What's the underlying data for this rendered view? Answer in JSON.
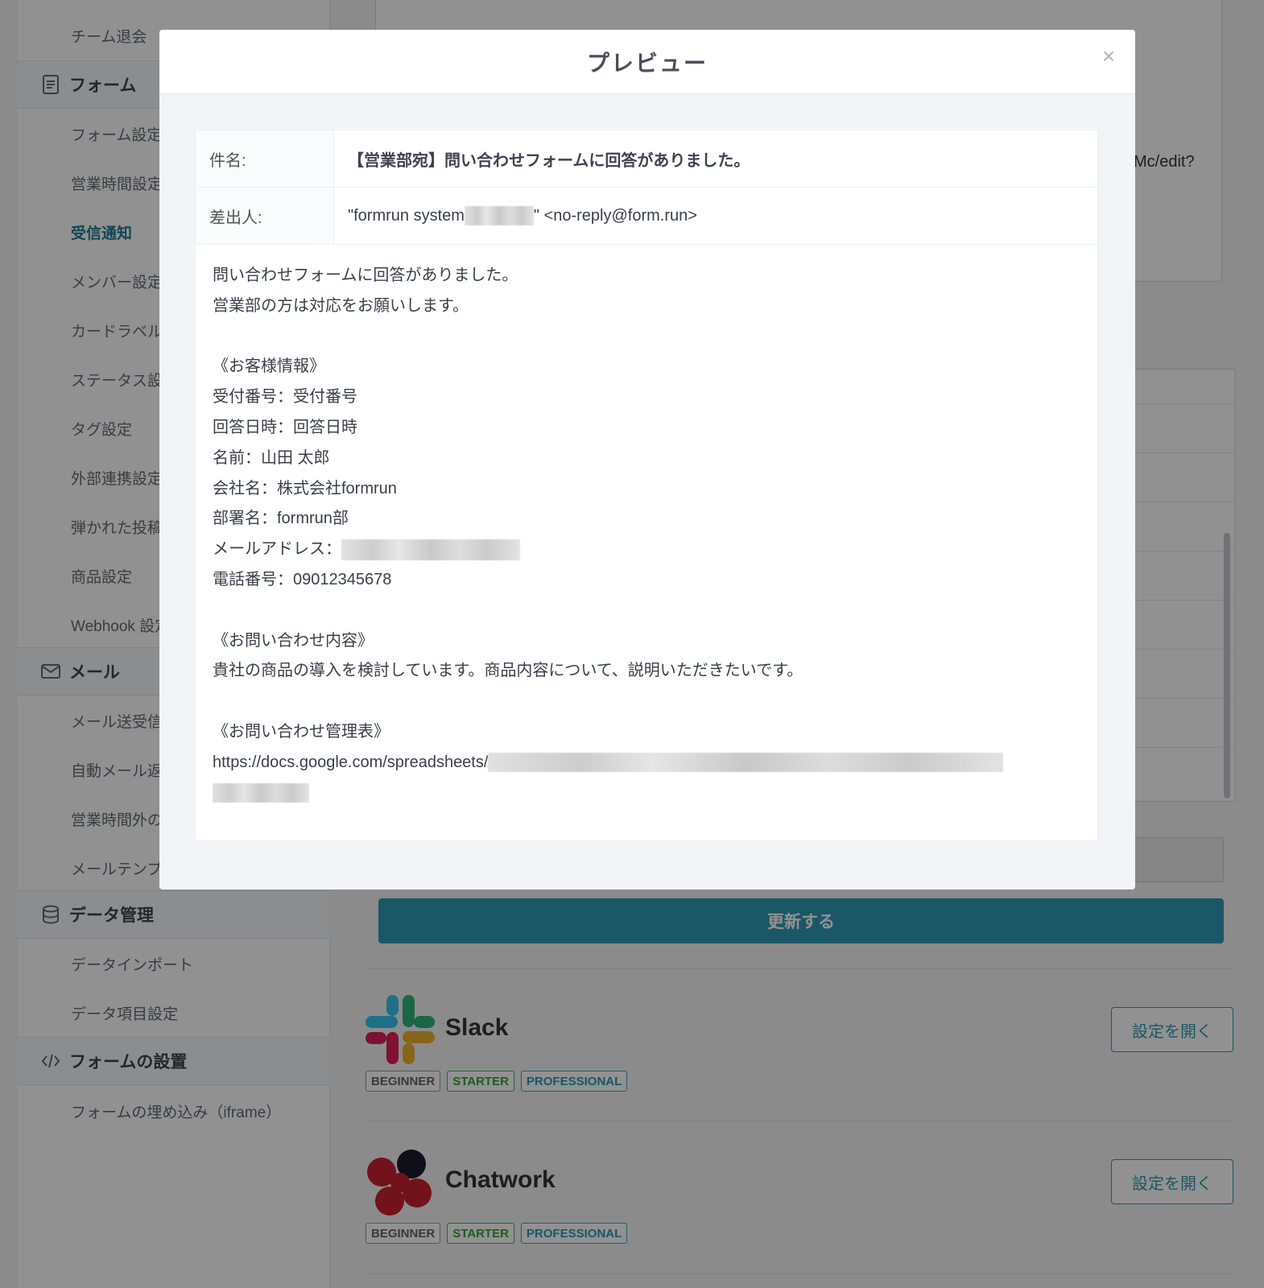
{
  "sidebar": {
    "items_top": [
      {
        "label": "チーム退会"
      }
    ],
    "sections": [
      {
        "label": "フォーム",
        "items": [
          "フォーム設定",
          "営業時間設定",
          "受信通知",
          "メンバー設定",
          "カードラベル",
          "ステータス設",
          "タグ設定",
          "外部連携設定",
          "弾かれた投稿",
          "商品設定",
          "Webhook 設定"
        ]
      },
      {
        "label": "メール",
        "items": [
          "メール送受信",
          "自動メール返",
          "営業時間外の",
          "メールテンプ"
        ]
      },
      {
        "label": "データ管理",
        "items": [
          "データインポート",
          "データ項目設定"
        ]
      },
      {
        "label": "フォームの設置",
        "items": [
          "フォームの埋め込み（iframe）"
        ]
      }
    ],
    "active_item": "受信通知"
  },
  "main": {
    "url_fragment": "Mc/edit?",
    "update_button": "更新する",
    "integrations": [
      {
        "name": "Slack",
        "plans": [
          "BEGINNER",
          "STARTER",
          "PROFESSIONAL"
        ],
        "button": "設定を開く"
      },
      {
        "name": "Chatwork",
        "plans": [
          "BEGINNER",
          "STARTER",
          "PROFESSIONAL"
        ],
        "button": "設定を開く"
      }
    ]
  },
  "modal": {
    "title": "プレビュー",
    "close_symbol": "×",
    "subject_label": "件名:",
    "subject_value": "【営業部宛】問い合わせフォームに回答がありました。",
    "sender_label": "差出人:",
    "sender_prefix": "\"formrun system",
    "sender_suffix": "\" <no-reply@form.run>",
    "body": {
      "intro1": "問い合わせフォームに回答がありました。",
      "intro2": "営業部の方は対応をお願いします。",
      "customer_heading": "《お客様情報》",
      "receipt": "受付番号：受付番号",
      "answered_at": "回答日時：回答日時",
      "name": "名前：山田 太郎",
      "company": "会社名：株式会社formrun",
      "department": "部署名：formrun部",
      "email_label": "メールアドレス：",
      "phone": "電話番号：09012345678",
      "inquiry_heading": "《お問い合わせ内容》",
      "inquiry": "貴社の商品の導入を検討しています。商品内容について、説明いただきたいです。",
      "sheet_heading": "《お問い合わせ管理表》",
      "sheet_url_prefix": "https://docs.google.com/spreadsheets/"
    }
  },
  "colors": {
    "accent": "#2f9ab5",
    "active_nav": "#1f7d92",
    "overlay": "rgba(0,0,0,0.43)"
  }
}
